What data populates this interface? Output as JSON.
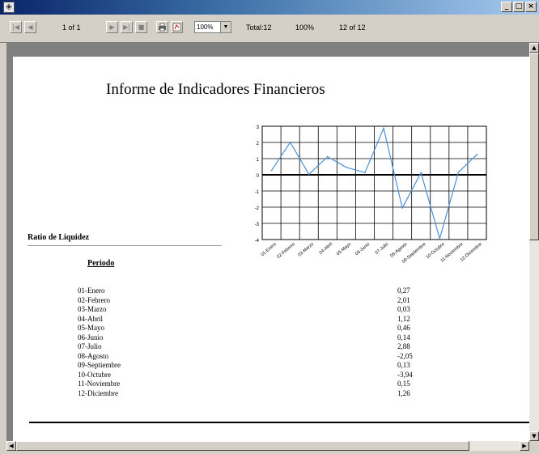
{
  "window": {
    "icon": "app-icon",
    "controls": [
      "_",
      "□",
      "×"
    ]
  },
  "toolbar": {
    "first_icon": "|◀",
    "prev_icon": "◀",
    "page_of": "1 of 1",
    "next_icon": "▶",
    "last_icon": "▶|",
    "stop_icon": "■",
    "print_icon": "printer-icon",
    "export_icon": "export-icon",
    "zoom_value": "100%",
    "total_label": "Total:12",
    "percent_label": "100%",
    "count_label": "12 of 12"
  },
  "report": {
    "title": "Informe de Indicadores Financieros",
    "section_title": "Ratio de Liquidez",
    "period_header": "Periodo",
    "rows": [
      {
        "period": "01-Enero",
        "value": "0,27"
      },
      {
        "period": "02-Febrero",
        "value": "2,01"
      },
      {
        "period": "03-Marzo",
        "value": "0,03"
      },
      {
        "period": "04-Abril",
        "value": "1,12"
      },
      {
        "period": "05-Mayo",
        "value": "0,46"
      },
      {
        "period": "06-Junio",
        "value": "0,14"
      },
      {
        "period": "07-Julio",
        "value": "2,88"
      },
      {
        "period": "08-Agosto",
        "value": "-2,05"
      },
      {
        "period": "09-Septiembre",
        "value": "0,13"
      },
      {
        "period": "10-Octubre",
        "value": "-3,94"
      },
      {
        "period": "11-Noviembre",
        "value": "0,15"
      },
      {
        "period": "12-Diciembre",
        "value": "1,26"
      }
    ]
  },
  "chart_data": {
    "type": "line",
    "categories": [
      "01-Enero",
      "02-Febrero",
      "03-Marzo",
      "04-Abril",
      "05-Mayo",
      "06-Junio",
      "07-Julio",
      "08-Agosto",
      "09-Septiembre",
      "10-Octubre",
      "11-Noviembre",
      "12-Diciembre"
    ],
    "values": [
      0.27,
      2.01,
      0.03,
      1.12,
      0.46,
      0.14,
      2.88,
      -2.05,
      0.13,
      -3.94,
      0.15,
      1.26
    ],
    "yticks": [
      "3",
      "2",
      "1",
      "0",
      "-1",
      "-2",
      "-3",
      "-4"
    ],
    "ylim": [
      -4,
      3
    ],
    "grid": true,
    "line_color": "#4a90d9"
  }
}
